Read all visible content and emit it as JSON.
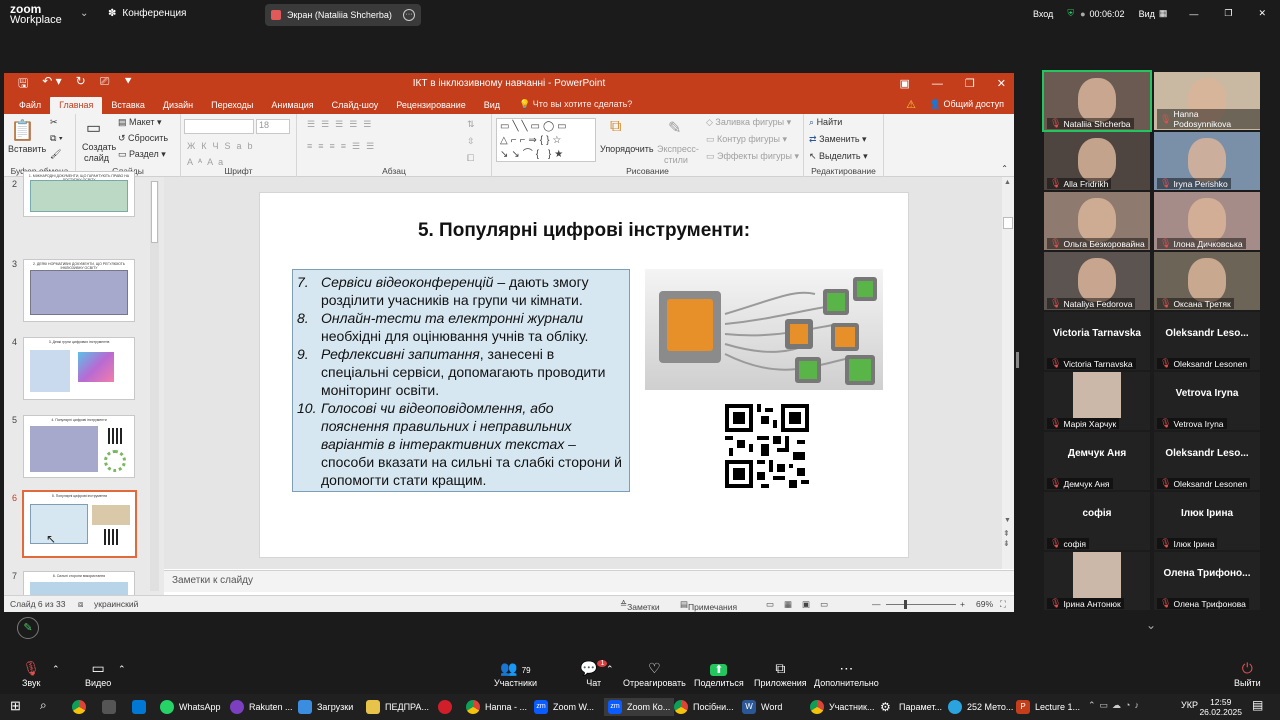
{
  "zoom": {
    "logo_top": "zoom",
    "logo_bottom": "Workplace",
    "meeting_title": "Конференция",
    "share_label": "Экран (Nataliia Shcherba)",
    "login": "Вход",
    "timer": "00:06:02",
    "view": "Вид"
  },
  "ppt": {
    "title": "ІКТ в інклюзивному навчанні - PowerPoint",
    "tabs": [
      "Файл",
      "Главная",
      "Вставка",
      "Дизайн",
      "Переходы",
      "Анимация",
      "Слайд-шоу",
      "Рецензирование",
      "Вид"
    ],
    "tell_me": "Что вы хотите сделать?",
    "share": "Общий доступ",
    "ribbon": {
      "paste": "Вставить",
      "clipboard": "Буфер обмена",
      "new_slide_1": "Создать",
      "new_slide_2": "слайд",
      "layout": "Макет",
      "reset": "Сбросить",
      "section": "Раздел",
      "slides": "Слайды",
      "font_size": "18",
      "font": "Шрифт",
      "paragraph": "Абзац",
      "arrange": "Упорядочить",
      "quick_styles_1": "Экспресс-",
      "quick_styles_2": "стили",
      "shape_fill": "Заливка фигуры",
      "shape_outline": "Контур фигуры",
      "shape_effects": "Эффекты фигуры",
      "drawing": "Рисование",
      "find": "Найти",
      "replace": "Заменить",
      "select": "Выделить",
      "editing": "Редактирование"
    },
    "thumb_numbers": [
      "2",
      "3",
      "4",
      "5",
      "6",
      "7"
    ],
    "thumb_captions": [
      "1. МІЖНАРОДНІ ДОКУМЕНТИ, ЩО ГАРАНТУЮТЬ ПРАВО НА ДОСТУПНУ ОСВІТУ",
      "2. ДЕЯКІ НОРМАТИВНІ ДОКУМЕНТИ, ЩО РЕГУЛЮЮТЬ ІНКЛЮЗИВНУ ОСВІТУ",
      "3. Деякі групи цифрових інструментів",
      "4. Популярні цифрові інструменти",
      "5. Популярні цифрові інструменти",
      "6. Сильні сторони використання"
    ],
    "slide": {
      "title": "5. Популярні цифрові інструменти:",
      "items": [
        {
          "num": "7.",
          "em": "Сервіси відеоконференцій",
          "rest": " – дають змогу розділити учасників на групи чи кімнати."
        },
        {
          "num": "8.",
          "em": "Онлайн-тести та електронні журнали",
          "rest": " необхідні для оцінювання учнів та обліку."
        },
        {
          "num": "9.",
          "em": "Рефлексивні запитання",
          "rest": ", занесені в спеціальні сервіси, допомагають проводити моніторинг освіти."
        },
        {
          "num": "10.",
          "em": "Голосові чи відеоповідомлення, або пояснення правильних і неправильних варіантів в інтерактивних текстах –",
          "rest": " способи вказати на сильні та слабкі сторони й допомогти стати кращим."
        }
      ]
    },
    "notes_placeholder": "Заметки к слайду",
    "status": {
      "slide_of": "Слайд 6 из 33",
      "language": "украинский",
      "notes": "Заметки",
      "comments": "Примечания",
      "zoom": "69%"
    }
  },
  "participants": [
    {
      "name": "Nataliia Shcherba",
      "video": true
    },
    {
      "name": "Hanna Podosynnikova",
      "video": true
    },
    {
      "name": "Alla Fridrikh",
      "video": true
    },
    {
      "name": "Iryna Perishko",
      "video": true
    },
    {
      "name": "Ольга Безкоровайна",
      "video": true
    },
    {
      "name": "Ілона Дичковська",
      "video": true
    },
    {
      "name": "Nataliya Fedorova",
      "video": true
    },
    {
      "name": "Оксана Третяк",
      "video": true
    },
    {
      "name": "Victoria Tarnavska",
      "big": "Victoria Tarnavska"
    },
    {
      "name": "Oleksandr Lesonen",
      "big": "Oleksandr  Leso..."
    },
    {
      "name": "Марія Харчук",
      "avatar": true
    },
    {
      "name": "Vetrova Iryna",
      "big": "Vetrova Iryna"
    },
    {
      "name": "Демчук Аня",
      "big": "Демчук Аня"
    },
    {
      "name": "Oleksandr Lesonen",
      "big": "Oleksandr  Leso..."
    },
    {
      "name": "софія",
      "big": "софія"
    },
    {
      "name": "Ілюк Ірина",
      "big": "Ілюк Ірина"
    },
    {
      "name": "Ірина Антонюк",
      "avatar": true
    },
    {
      "name": "Олена Трифонова",
      "big": "Олена  Трифоно..."
    }
  ],
  "toolbar": {
    "audio": "Звук",
    "video": "Видео",
    "participants": "Участники",
    "participants_count": "79",
    "chat": "Чат",
    "chat_badge": "1",
    "react": "Отреагировать",
    "share": "Поделиться",
    "apps": "Приложения",
    "more": "Дополнительно",
    "leave": "Выйти"
  },
  "taskbar": {
    "apps": [
      "WhatsApp",
      "Rakuten ...",
      "Загрузки",
      "ПЕДПРА...",
      "Hanna - ...",
      "Zoom W...",
      "Zoom Ко...",
      "Посібни...",
      "Word",
      "Участник...",
      "Парамет...",
      "252 Мето...",
      "Lecture 1..."
    ],
    "lang": "УКР",
    "time": "12:59",
    "date": "26.02.2025"
  },
  "colors": {
    "ppt_accent": "#c43e1c",
    "slide_box": "#d6e7f1",
    "zoom_green": "#0e71eb"
  }
}
